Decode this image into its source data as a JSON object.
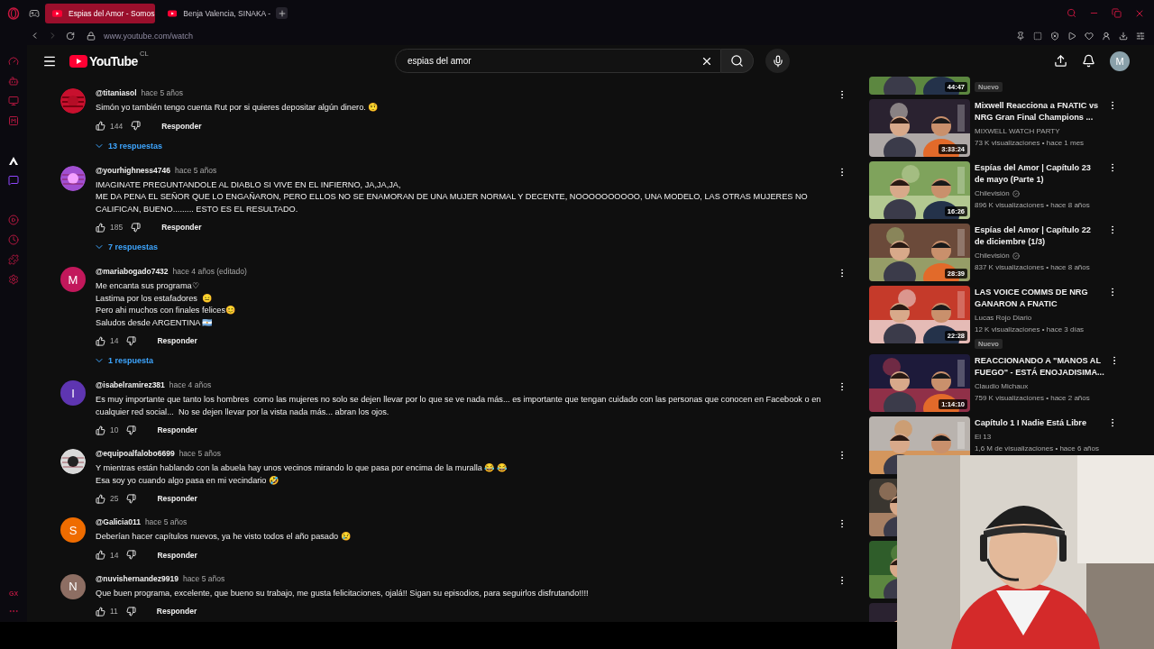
{
  "browser": {
    "tabs": [
      {
        "title": "Espias del Amor - Somos",
        "selected": true
      },
      {
        "title": "Benja Valencia, SINAKA -",
        "selected": false
      }
    ],
    "address": "www.youtube.com/watch"
  },
  "opera_sidebar": {
    "badge": "GX"
  },
  "masthead": {
    "logo": "YouTube",
    "country": "CL",
    "search": {
      "value": "espias del amor"
    },
    "account_initial": "M"
  },
  "comments": [
    {
      "avatar": {
        "kind": "picture"
      },
      "author": "@titaniasol",
      "time": "hace 5 años",
      "lines": [
        "Simón yo también tengo cuenta Rut por si quieres depositar algún dinero. 🤨"
      ],
      "likes": "144",
      "reply": "Responder",
      "replies": "13 respuestas"
    },
    {
      "avatar": {
        "kind": "picture"
      },
      "author": "@yourhighness4746",
      "time": "hace 5 años",
      "lines": [
        "IMAGINATE PREGUNTANDOLE AL DIABLO SI VIVE EN EL INFIERNO, JA,JA,JA,",
        "ME DA PENA EL SEÑOR QUE LO ENGAÑARON, PERO ELLOS NO SE ENAMORAN DE UNA MUJER NORMAL Y DECENTE, NOOOOOOOOOO, UNA MODELO, LAS OTRAS MUJERES NO",
        "CALIFICAN, BUENO......... ESTO ES EL RESULTADO."
      ],
      "likes": "185",
      "reply": "Responder",
      "replies": "7 respuestas"
    },
    {
      "avatar": {
        "kind": "letter",
        "letter": "M",
        "color": "#c2185b"
      },
      "author": "@mariabogado7432",
      "time": "hace 4 años (editado)",
      "lines": [
        "Me encanta sus programa♡",
        "Lastima por los estafadores  😑",
        "Pero ahi muchos con finales felices😊",
        "Saludos desde ARGENTINA 🇦🇷"
      ],
      "likes": "14",
      "reply": "Responder",
      "replies": "1 respuesta"
    },
    {
      "avatar": {
        "kind": "letter",
        "letter": "I",
        "color": "#5e35b1"
      },
      "author": "@isabelramirez381",
      "time": "hace 4 años",
      "lines": [
        "Es muy importante que tanto los hombres  como las mujeres no solo se dejen llevar por lo que se ve nada más... es importante que tengan cuidado con las personas que conocen en Facebook o en",
        "cualquier red social...  No se dejen llevar por la vista nada más... abran los ojos."
      ],
      "likes": "10",
      "reply": "Responder"
    },
    {
      "avatar": {
        "kind": "picture"
      },
      "author": "@equipoalfalobo6699",
      "time": "hace 5 años",
      "lines": [
        "Y mientras están hablando con la abuela hay unos vecinos mirando lo que pasa por encima de la muralla 😂 😂",
        "Esa soy yo cuando algo pasa en mi vecindario 🤣"
      ],
      "likes": "25",
      "reply": "Responder"
    },
    {
      "avatar": {
        "kind": "letter",
        "letter": "S",
        "color": "#ef6c00"
      },
      "author": "@Galicia011",
      "time": "hace 5 años",
      "lines": [
        "Deberían hacer capítulos nuevos, ya he visto todos el año pasado 😢"
      ],
      "likes": "14",
      "reply": "Responder"
    },
    {
      "avatar": {
        "kind": "letter",
        "letter": "N",
        "color": "#8d6e63"
      },
      "author": "@nuvishernandez9919",
      "time": "hace 5 años",
      "lines": [
        "Que buen programa, excelente, que bueno su trabajo, me gusta felicitaciones, ojalá!! Sigan su episodios, para seguirlos disfrutando!!!!"
      ],
      "likes": "11",
      "reply": "Responder"
    }
  ],
  "sidebar": {
    "items": [
      {
        "kind": "cut",
        "duration": "44:47",
        "badge": "Nuevo"
      },
      {
        "kind": "full",
        "title": [
          "Mixwell Reacciona a FNATIC vs",
          "NRG Gran Final Champions ..."
        ],
        "channel": "MIXWELL WATCH PARTY",
        "meta": "73 K visualizaciones • hace 1 mes",
        "duration": "3:33:24"
      },
      {
        "kind": "full",
        "title": [
          "Espías del Amor | Capítulo 23",
          "de mayo (Parte 1)"
        ],
        "channel": "Chilevisión",
        "verified": true,
        "meta": "896 K visualizaciones • hace 8 años",
        "duration": "16:26"
      },
      {
        "kind": "full",
        "title": [
          "Espías del Amor | Capítulo 22",
          "de diciembre (1/3)"
        ],
        "channel": "Chilevisión",
        "verified": true,
        "meta": "837 K visualizaciones • hace 8 años",
        "duration": "28:39"
      },
      {
        "kind": "full",
        "title": [
          "LAS VOICE COMMS DE NRG",
          "GANARON A FNATIC"
        ],
        "channel": "Lucas Rojo Diario",
        "meta": "12 K visualizaciones • hace 3 días",
        "duration": "22:28",
        "badge": "Nuevo"
      },
      {
        "kind": "full",
        "title": [
          "REACCIONANDO A \"MANOS AL",
          "FUEGO\" - ESTÁ ENOJADISIMA..."
        ],
        "channel": "Claudio Michaux",
        "meta": "759 K visualizaciones • hace 2 años",
        "duration": "1:14:10"
      },
      {
        "kind": "full",
        "title": [
          "Capítulo 1 I Nadie Está Libre"
        ],
        "channel": "El 13",
        "meta": "1,6 M de visualizaciones • hace 6 años"
      },
      {
        "kind": "thumb"
      },
      {
        "kind": "thumb"
      },
      {
        "kind": "thumb"
      }
    ]
  },
  "webcam": {
    "kind": "picture"
  }
}
